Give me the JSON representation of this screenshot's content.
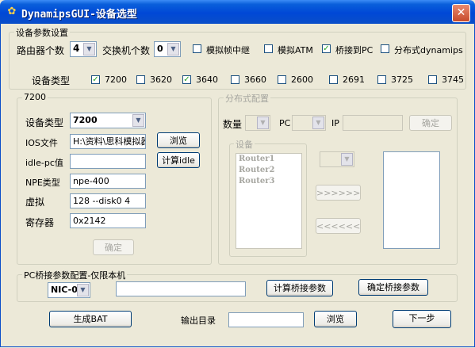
{
  "window": {
    "title": "DynamipsGUI-设备选型",
    "close_symbol": "✕"
  },
  "device_params": {
    "group_label": "设备参数设置",
    "router_count_label": "路由器个数",
    "router_count_value": "4",
    "switch_count_label": "交换机个数",
    "switch_count_value": "0",
    "options": [
      {
        "label": "模拟帧中继",
        "checked": false
      },
      {
        "label": "模拟ATM",
        "checked": false
      },
      {
        "label": "桥接到PC",
        "checked": true
      },
      {
        "label": "分布式dynamips",
        "checked": false
      }
    ],
    "device_type_label": "设备类型",
    "device_types": [
      {
        "label": "7200",
        "checked": true
      },
      {
        "label": "3620",
        "checked": false
      },
      {
        "label": "3640",
        "checked": true
      },
      {
        "label": "3660",
        "checked": false
      },
      {
        "label": "2600",
        "checked": false
      },
      {
        "label": "2691",
        "checked": false
      },
      {
        "label": "3725",
        "checked": false
      },
      {
        "label": "3745",
        "checked": false
      }
    ]
  },
  "model_group": {
    "label": "7200",
    "device_type_label": "设备类型",
    "device_type_value": "7200",
    "ios_label": "IOS文件",
    "ios_value": "H:\\资料\\思科模拟器",
    "browse_label": "浏览",
    "idle_label": "idle-pc值",
    "idle_value": "",
    "calc_idle_label": "计算idle",
    "npe_label": "NPE类型",
    "npe_value": "npe-400",
    "virtual_label": "虚拟",
    "virtual_value": "128 --disk0 4",
    "register_label": "寄存器",
    "register_value": "0x2142",
    "confirm_label": "确定"
  },
  "distributed": {
    "group_label": "分布式配置",
    "count_label": "数量",
    "pc_label": "PC",
    "ip_label": "IP",
    "confirm_label": "确定",
    "devices_label": "设备",
    "devices": [
      "Router1",
      "Router2",
      "Router3"
    ],
    "move_right_label": ">>>>>>",
    "move_left_label": "<<<<<<"
  },
  "bridge": {
    "group_label": "PC桥接参数配置-仅限本机",
    "nic_value": "NIC-0",
    "param_value": "",
    "calc_label": "计算桥接参数",
    "confirm_label": "确定桥接参数"
  },
  "bottom": {
    "generate_bat_label": "生成BAT",
    "output_dir_label": "输出目录",
    "output_dir_value": "",
    "browse_label": "浏览",
    "next_label": "下一步"
  },
  "colors": {
    "titlebar": "#0a5fdb",
    "window_bg": "#ece9d8",
    "check_mark": "#21a121",
    "disabled_text": "#a6a6a0"
  }
}
